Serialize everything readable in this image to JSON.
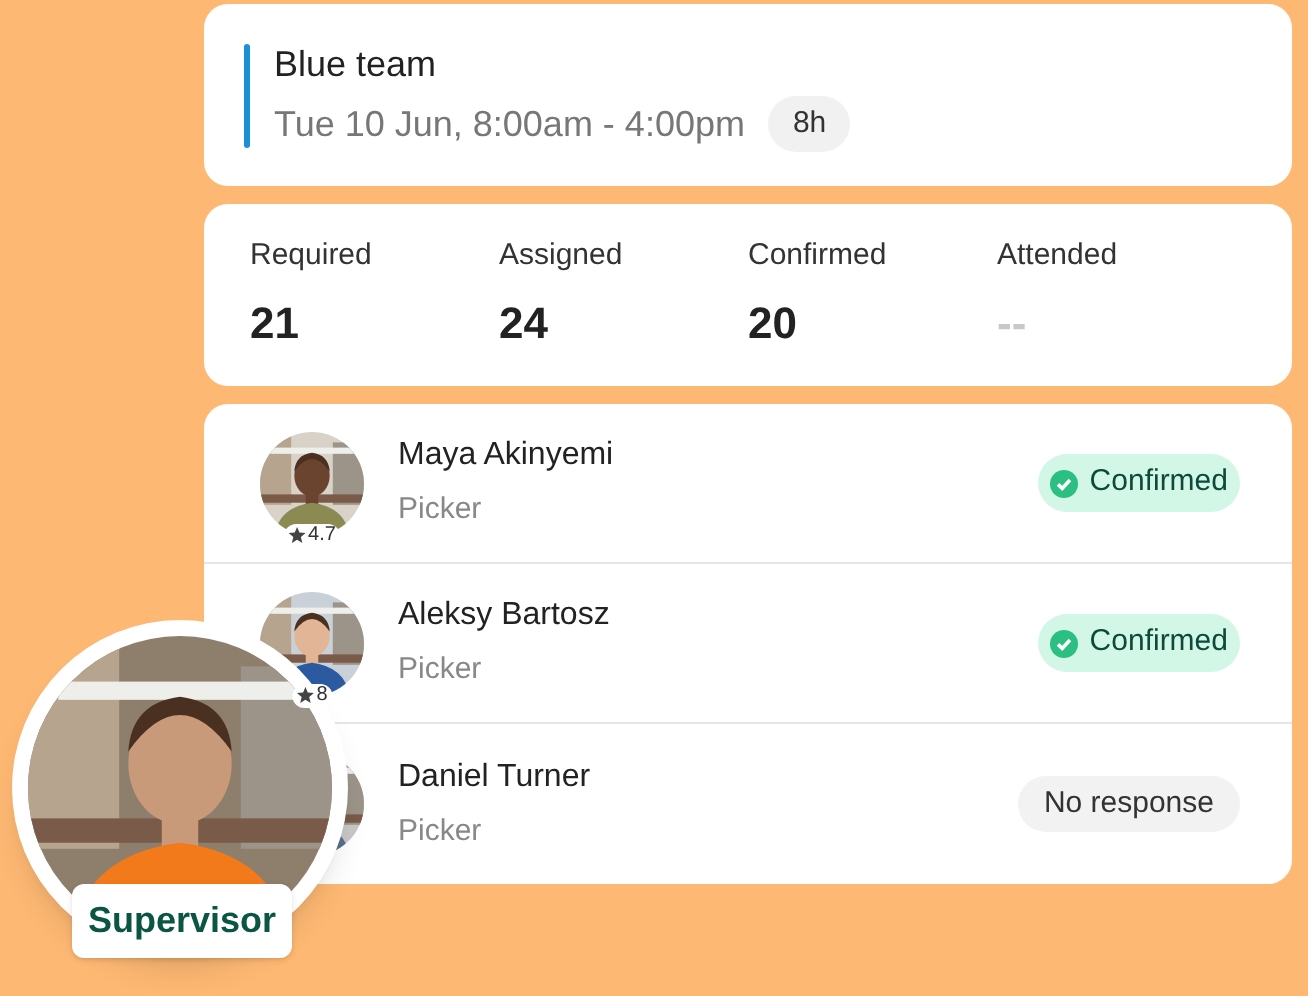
{
  "shift": {
    "team": "Blue team",
    "time": "Tue 10 Jun, 8:00am - 4:00pm",
    "duration": "8h"
  },
  "stats": [
    {
      "label": "Required",
      "value": "21",
      "kind": "number"
    },
    {
      "label": "Assigned",
      "value": "24",
      "kind": "number"
    },
    {
      "label": "Confirmed",
      "value": "20",
      "kind": "number"
    },
    {
      "label": "Attended",
      "value": "--",
      "kind": "empty"
    }
  ],
  "workers": [
    {
      "name": "Maya Akinyemi",
      "role": "Picker",
      "rating": "4.7",
      "status": "Confirmed",
      "kind": "confirmed"
    },
    {
      "name": "Aleksy Bartosz",
      "role": "Picker",
      "rating": "8",
      "status": "Confirmed",
      "kind": "confirmed"
    },
    {
      "name": "Daniel Turner",
      "role": "Picker",
      "status": "No response",
      "kind": "no_response"
    }
  ],
  "supervisor": {
    "label": "Supervisor"
  }
}
